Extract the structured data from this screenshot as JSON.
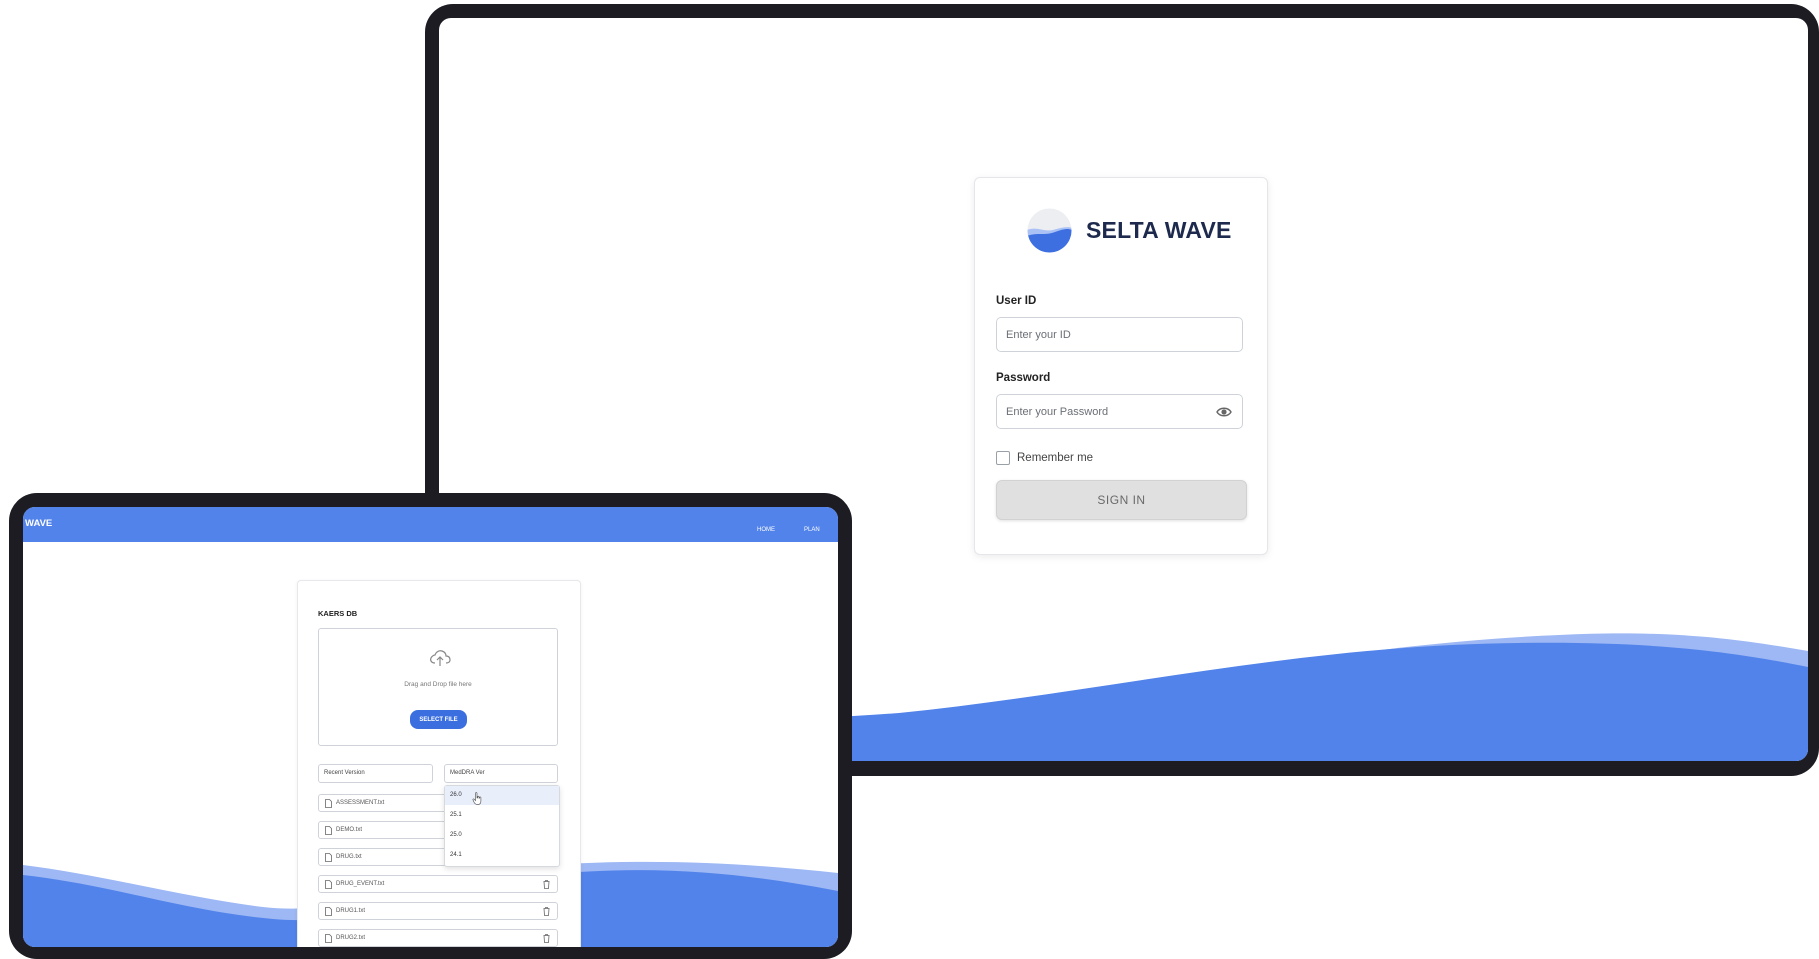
{
  "login": {
    "brand_name": "SELTA WAVE",
    "user_id_label": "User ID",
    "user_id_placeholder": "Enter your ID",
    "password_label": "Password",
    "password_placeholder": "Enter your Password",
    "remember_label": "Remember me",
    "sign_in_label": "SIGN IN",
    "icons": {
      "logo": "wave-logo-icon",
      "password_toggle": "eye-icon"
    }
  },
  "app": {
    "brand": "WAVE",
    "nav": [
      "HOME",
      "PLAN"
    ],
    "panel_title": "KAERS DB",
    "dropzone_text": "Drag and Drop file here",
    "select_file_label": "SELECT FILE",
    "recent_version_label": "Recent Version",
    "meddra_label": "MedDRA Ver",
    "meddra_options": [
      "26.0",
      "25.1",
      "25.0",
      "24.1"
    ],
    "meddra_highlighted": "26.0",
    "files": [
      "ASSESSMENT.txt",
      "DEMO.txt",
      "DRUG.txt",
      "DRUG_EVENT.txt",
      "DRUG1.txt",
      "DRUG2.txt"
    ],
    "icons": {
      "upload": "cloud-upload-icon",
      "file": "file-icon",
      "delete": "trash-icon",
      "pointer": "hand-cursor-icon"
    }
  },
  "colors": {
    "accent": "#5283ea",
    "button": "#3b6fe0",
    "device_frame": "#1c1c22",
    "brand_text": "#1d2a4d"
  }
}
